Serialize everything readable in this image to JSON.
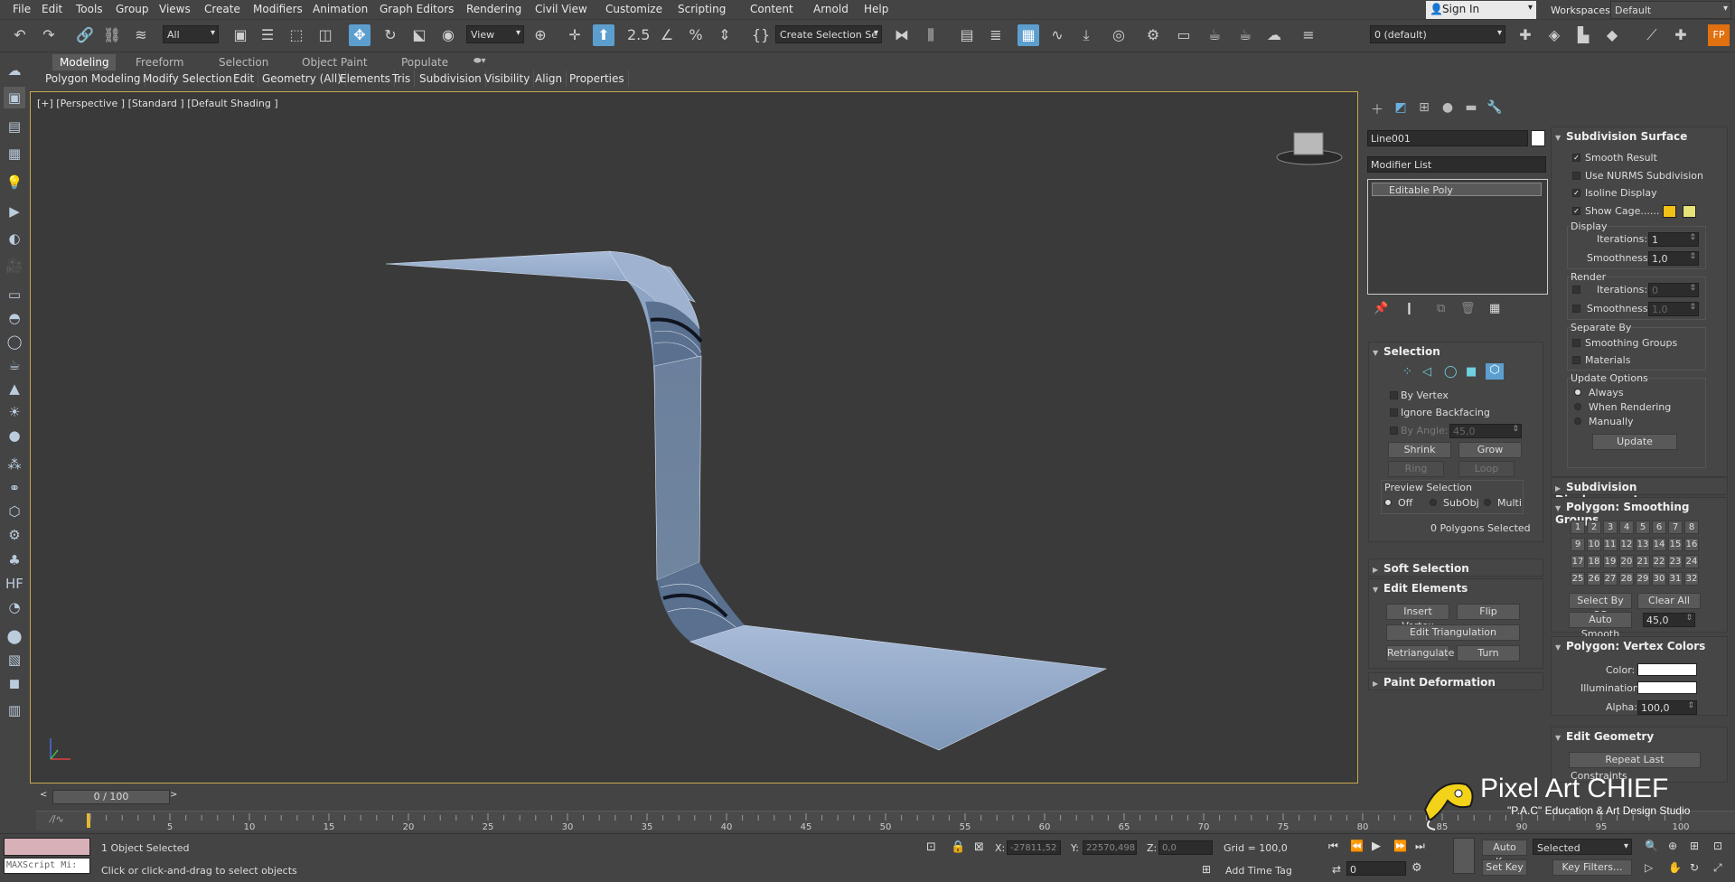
{
  "menu": [
    "File",
    "Edit",
    "Tools",
    "Group",
    "Views",
    "Create",
    "Modifiers",
    "Animation",
    "Graph Editors",
    "Rendering",
    "Civil View",
    "Customize",
    "Scripting",
    "Content",
    "Arnold",
    "Help"
  ],
  "signin": "Sign In",
  "workspaces": {
    "label": "Workspaces:",
    "value": "Default"
  },
  "toolbar": {
    "filter": "All",
    "refcoord": "View",
    "selset": "Create Selection Se",
    "layer": "0 (default)"
  },
  "ribbon": {
    "tabs": [
      "Modeling",
      "Freeform",
      "Selection",
      "Object Paint",
      "Populate"
    ],
    "sub": [
      "Polygon Modeling",
      "Modify Selection",
      "Edit",
      "Geometry (All)",
      "Elements",
      "Tris",
      "Subdivision",
      "Visibility",
      "Align",
      "Properties"
    ]
  },
  "viewport": {
    "label": "[+] [Perspective ] [Standard ] [Default Shading ]"
  },
  "cmd": {
    "object_name": "Line001",
    "modifier_list": "Modifier List",
    "stack_item": "Editable Poly"
  },
  "selection": {
    "title": "Selection",
    "by_vertex": "By Vertex",
    "ignore_backfacing": "Ignore Backfacing",
    "by_angle": "By Angle:",
    "angle": "45,0",
    "shrink": "Shrink",
    "grow": "Grow",
    "ring": "Ring",
    "loop": "Loop",
    "preview": "Preview Selection",
    "off": "Off",
    "subobj": "SubObj",
    "multi": "Multi",
    "count": "0 Polygons Selected"
  },
  "soft_selection": "Soft Selection",
  "edit_elements": {
    "title": "Edit Elements",
    "insert_vertex": "Insert Vertex",
    "flip": "Flip",
    "edit_tri": "Edit Triangulation",
    "retri": "Retriangulate",
    "turn": "Turn"
  },
  "paint_deformation": "Paint Deformation",
  "subdiv": {
    "title": "Subdivision Surface",
    "smooth": "Smooth Result",
    "nurms": "Use NURMS Subdivision",
    "isoline": "Isoline Display",
    "cage": "Show Cage......",
    "display": "Display",
    "iter_label": "Iterations:",
    "iter": "1",
    "smooth_label": "Smoothness:",
    "smoothness": "1,0",
    "render": "Render",
    "r_iter": "0",
    "r_smooth": "1,0",
    "separate": "Separate By",
    "sg": "Smoothing Groups",
    "materials": "Materials",
    "update_opts": "Update Options",
    "always": "Always",
    "when_rendering": "When Rendering",
    "manually": "Manually",
    "update": "Update",
    "cage_color1": "#f2c118",
    "cage_color2": "#e8e27a"
  },
  "subdiv_disp": "Subdivision Displacement",
  "smoothing": {
    "title": "Polygon: Smoothing Groups",
    "groups": [
      "1",
      "2",
      "3",
      "4",
      "5",
      "6",
      "7",
      "8",
      "9",
      "10",
      "11",
      "12",
      "13",
      "14",
      "15",
      "16",
      "17",
      "18",
      "19",
      "20",
      "21",
      "22",
      "23",
      "24",
      "25",
      "26",
      "27",
      "28",
      "29",
      "30",
      "31",
      "32"
    ],
    "select_by_sg": "Select By SG",
    "clear_all": "Clear All",
    "auto_smooth": "Auto Smooth",
    "auto_val": "45,0"
  },
  "vcolors": {
    "title": "Polygon: Vertex Colors",
    "color": "Color:",
    "illum": "Illumination:",
    "alpha": "Alpha:",
    "alpha_val": "100,0"
  },
  "edit_geom": {
    "title": "Edit Geometry",
    "repeat": "Repeat Last",
    "constraints": "Constraints"
  },
  "timeline": {
    "frame": "0 / 100",
    "ticks": [
      "0",
      "5",
      "10",
      "15",
      "20",
      "25",
      "30",
      "35",
      "40",
      "45",
      "50",
      "55",
      "60",
      "65",
      "70",
      "75",
      "80",
      "85",
      "90",
      "95",
      "100"
    ]
  },
  "status": {
    "maxscript": "MAXScript Mi:",
    "objects": "1 Object Selected",
    "hint": "Click or click-and-drag to select objects",
    "x_label": "X:",
    "x": "-27811,52",
    "y_label": "Y:",
    "y": "22570,498",
    "z_label": "Z:",
    "z": "0,0",
    "grid": "Grid = 100,0",
    "add_time_tag": "Add Time Tag",
    "autokey": "Auto Key",
    "selected": "Selected",
    "setkey": "Set Key",
    "keyfilters": "Key Filters...",
    "frame_val": "0"
  },
  "logo": {
    "title": "Pixel Art CHIEF",
    "sub": "\"P.A.C\" Education & Art Design Studio"
  }
}
